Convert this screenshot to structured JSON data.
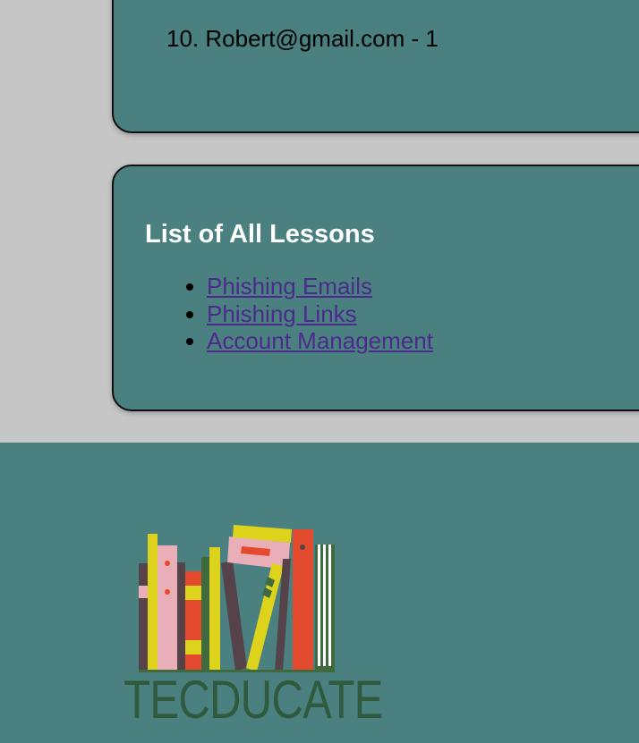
{
  "leaderboard": {
    "entry_number": "10.",
    "entry_text": "Robert@gmail.com - 1"
  },
  "lessons": {
    "title": "List of All Lessons",
    "items": [
      {
        "label": "Phishing Emails"
      },
      {
        "label": "Phishing Links"
      },
      {
        "label": "Account Management"
      }
    ]
  },
  "footer": {
    "logo_text": "TECDUCATE"
  },
  "colors": {
    "page_background": "#c6c6c6",
    "card_background": "#4a8080",
    "link": "#4b2a8c",
    "logo_text": "#2f5a3e"
  }
}
